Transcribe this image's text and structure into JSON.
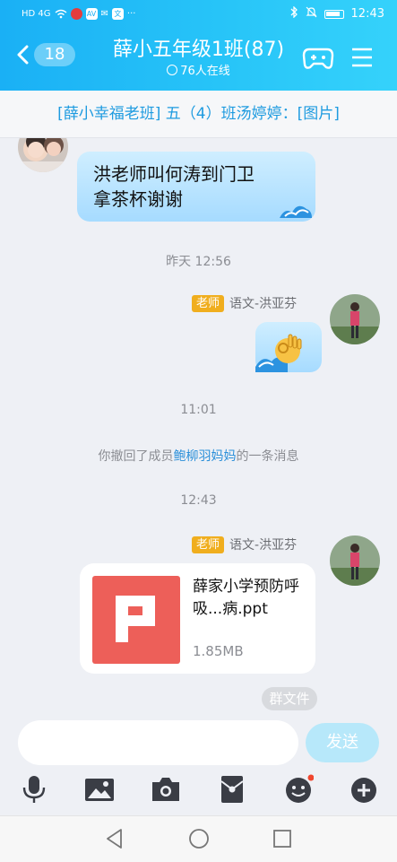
{
  "status": {
    "time": "12:43",
    "carrier_glyphs": "HD 4G",
    "app_badge_1": "AV",
    "app_badge_2": "文",
    "more": "···"
  },
  "header": {
    "unread_count": "18",
    "title": "薛小五年级1班(87)",
    "online": "76人在线"
  },
  "pinned": {
    "text": "[薛小幸福老班] 五（4）班汤婷婷：[图片]"
  },
  "messages": {
    "incoming_text": {
      "line1": "洪老师叫何涛到门卫",
      "line2": "拿茶杯谢谢"
    },
    "time1": "昨天 12:56",
    "sender1": {
      "tag": "老师",
      "name": "语文-洪亚芬"
    },
    "sticker": {
      "icon": "ok-hand-sticker"
    },
    "time2": "11:01",
    "recall": {
      "prefix": "你撤回了成员",
      "member": "鲍柳羽妈妈",
      "suffix": "的一条消息"
    },
    "time3": "12:43",
    "sender2": {
      "tag": "老师",
      "name": "语文-洪亚芬"
    },
    "file": {
      "name": "薛家小学预防呼吸...病.ppt",
      "size": "1.85MB",
      "type_icon": "ppt-icon"
    },
    "group_files": "群文件"
  },
  "input": {
    "placeholder": "",
    "send_label": "发送"
  },
  "toolbar": [
    "mic-icon",
    "image-icon",
    "camera-icon",
    "red-packet-icon",
    "emoji-icon",
    "plus-icon"
  ],
  "colors": {
    "header": "#1ab0f5",
    "teacher_tag": "#f0ae1e",
    "link": "#2a8fd9",
    "ppt": "#ed5f59",
    "send": "#b7e8fa"
  }
}
